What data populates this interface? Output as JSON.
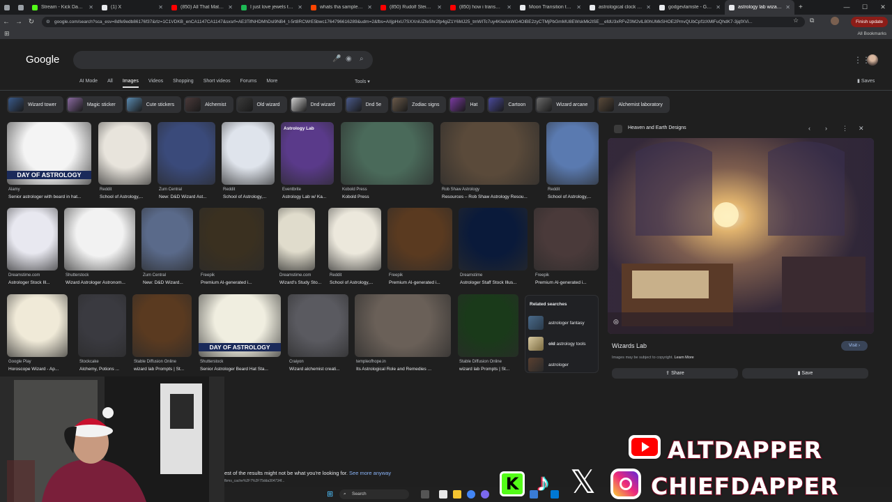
{
  "tabs": [
    {
      "label": "",
      "color": "#9aa0a6"
    },
    {
      "label": "",
      "color": "#9aa0a6"
    },
    {
      "label": "Stream - Kick Dashboard",
      "color": "#53fc18"
    },
    {
      "label": "(1) X",
      "color": "#e8eaed"
    },
    {
      "label": "(850) All That Matters R",
      "color": "#ff0000"
    },
    {
      "label": "I just love jewels tag by",
      "color": "#1db954"
    },
    {
      "label": "whats tha sample : r/sa",
      "color": "#ff4500"
    },
    {
      "label": "(850) Rudolf Steiner The",
      "color": "#ff0000"
    },
    {
      "label": "(850) how i transmuted",
      "color": "#ff0000"
    },
    {
      "label": "Moon Transition to Wor",
      "color": "#e8eaed"
    },
    {
      "label": "astrological clock praga",
      "color": "#e8eaed"
    },
    {
      "label": "godgevlamste - Google",
      "color": "#e8eaed"
    },
    {
      "label": "astrology lab wizard - G",
      "color": "#e8eaed",
      "active": true
    }
  ],
  "url": "google.com/search?sca_esv=8dfe9edb86176f37&rlz=1C1VDKB_enCA1147CA1147&sxsrf=AE3TifNHDMhDsl9NB4_t-5rt8RCWrE5bwc1764796616289&udm=2&fbs=AIIjpHxU7SXXniUZfeShr2fp4giZ1Y6MJ25_tmWITc7uy4KIeiAkWG4OlBE2zyCTMjPbGmMU8EWskMk2lSE__efdU3xRFvZ0M2vlL80hUMkSHOE2PmvQUbCpf1tXMlFuQhdK7-3jqfXVi...",
  "finish_update": "Finish update",
  "all_bookmarks": "All Bookmarks",
  "logo": "Google",
  "filters": [
    "AI Mode",
    "All",
    "Images",
    "Videos",
    "Shopping",
    "Short videos",
    "Forums",
    "More"
  ],
  "active_filter": "Images",
  "tools": "Tools",
  "saves": "Saves",
  "chips": [
    "Wizard tower",
    "Magic sticker",
    "Cute stickers",
    "Alchemist",
    "Old wizard",
    "Dnd wizard",
    "Dnd 5e",
    "Zodiac signs",
    "Hat",
    "Cartoon",
    "Wizard arcane",
    "Alchemist laboratory"
  ],
  "results": [
    {
      "source": "Alamy",
      "caption": "Senior astrologer with beard in hat..."
    },
    {
      "source": "Reddit",
      "caption": "School of Astrology,..."
    },
    {
      "source": "Zum Central",
      "caption": "New: D&D Wizard Ast..."
    },
    {
      "source": "Reddit",
      "caption": "School of Astrology,..."
    },
    {
      "source": "Eventbrite",
      "caption": "Astrology Lab w/ Ka..."
    },
    {
      "source": "Kobold Press",
      "caption": "Kobold Press"
    },
    {
      "source": "Rob Shaw Astrology",
      "caption": "Resources – Rob Shaw Astrology Resou..."
    },
    {
      "source": "Reddit",
      "caption": "School of Astrology,..."
    },
    {
      "source": "Dreamstime.com",
      "caption": "Astrologer Stock Ill..."
    },
    {
      "source": "Shutterstock",
      "caption": "Wizard Astrologer Astronom..."
    },
    {
      "source": "Zum Central",
      "caption": "New: D&D Wizard..."
    },
    {
      "source": "Freepik",
      "caption": "Premium AI-generated i..."
    },
    {
      "source": "Dreamstime.com",
      "caption": "Wizard's Study Sto..."
    },
    {
      "source": "Reddit",
      "caption": "School of Astrology,..."
    },
    {
      "source": "Freepik",
      "caption": "Premium AI-generated i..."
    },
    {
      "source": "Dreamstime",
      "caption": "Astrologer Staff Stock Illus..."
    },
    {
      "source": "Freepik",
      "caption": "Premium AI-generated i..."
    },
    {
      "source": "Google Play",
      "caption": "Horoscope Wizard - Ap..."
    },
    {
      "source": "Stockcake",
      "caption": "Alchemy, Potions ..."
    },
    {
      "source": "Stable Diffusion Online",
      "caption": "wizard lab Prompts | St..."
    },
    {
      "source": "Shutterstock",
      "caption": "Senior Astrologer Beard Hat Sta..."
    },
    {
      "source": "Craiyon",
      "caption": "Wizard alchemist creati..."
    },
    {
      "source": "templeofhope.in",
      "caption": "Its Astrological Role and Remedies ..."
    },
    {
      "source": "Stable Diffusion Online",
      "caption": "wizard lab Prompts | St..."
    }
  ],
  "day_of_astrology": "DAY OF ASTROLOGY",
  "astrology_lab_thumb": "Astrology Lab",
  "related": {
    "heading": "Related searches",
    "items": [
      {
        "label": "astrologer fantasy"
      },
      {
        "label": "old astrology tools",
        "bold_prefix": "old"
      },
      {
        "label": "astrologer"
      }
    ]
  },
  "panel": {
    "source": "Heaven and Earth Designs",
    "title": "Wizards Lab",
    "visit": "Visit",
    "copyright": "Images may be subject to copyright.",
    "learn_more": "Learn More",
    "share": "Share",
    "save": "Save"
  },
  "more_results": "est of the results might not be what you're looking for.",
  "see_more": "See more anyway",
  "status_url": "fbms_cache%2F7%2F75dda304734f...",
  "taskbar_search": "Search",
  "overlay": {
    "line1": "ALTDAPPER",
    "line2": "CHIEFDAPPER"
  }
}
